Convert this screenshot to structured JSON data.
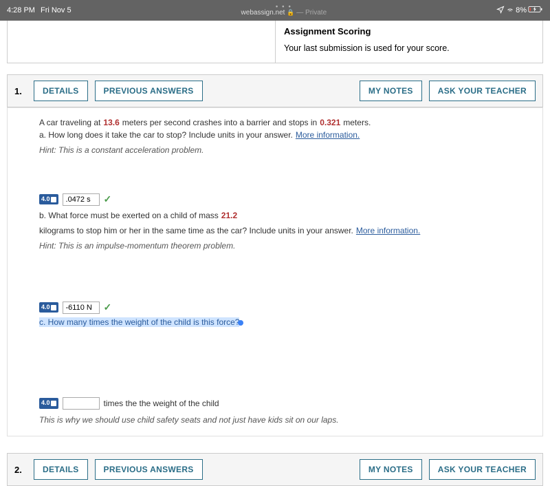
{
  "status": {
    "time": "4:28 PM",
    "date": "Fri Nov 5",
    "host": "webassign.net",
    "privacy": "— Private",
    "battery": "8%"
  },
  "scoring": {
    "title": "Assignment Scoring",
    "desc": "Your last submission is used for your score."
  },
  "buttons": {
    "details": "DETAILS",
    "previous": "PREVIOUS ANSWERS",
    "notes": "MY NOTES",
    "ask": "ASK YOUR TEACHER"
  },
  "q1": {
    "num": "1.",
    "intro_a": "A car traveling at ",
    "speed": "13.6",
    "intro_b": " meters per second crashes into a barrier and stops in ",
    "dist": "0.321",
    "intro_c": " meters.",
    "a_prompt": "a. How long does it take the car to stop? Include units in your answer. ",
    "more_info": "More information.",
    "a_hint": " Hint: This is a constant acceleration problem.",
    "badge": "4.0",
    "a_value": ".0472 s",
    "check": "✓",
    "b_prompt_a": "b. What force must be exerted on a child of mass ",
    "mass": "21.2",
    "b_prompt_b": " kilograms to stop him or her in the same time as the car? Include units in your answer. ",
    "b_hint": " Hint: This is an impulse-momentum theorem problem.",
    "b_value": "-6110 N",
    "c_prompt": "c. How many times the weight of the child is this force?",
    "c_suffix": " times the the weight of the child",
    "explain": "This is why we should use child safety seats and not just have kids sit on our laps."
  },
  "q2": {
    "num": "2."
  }
}
